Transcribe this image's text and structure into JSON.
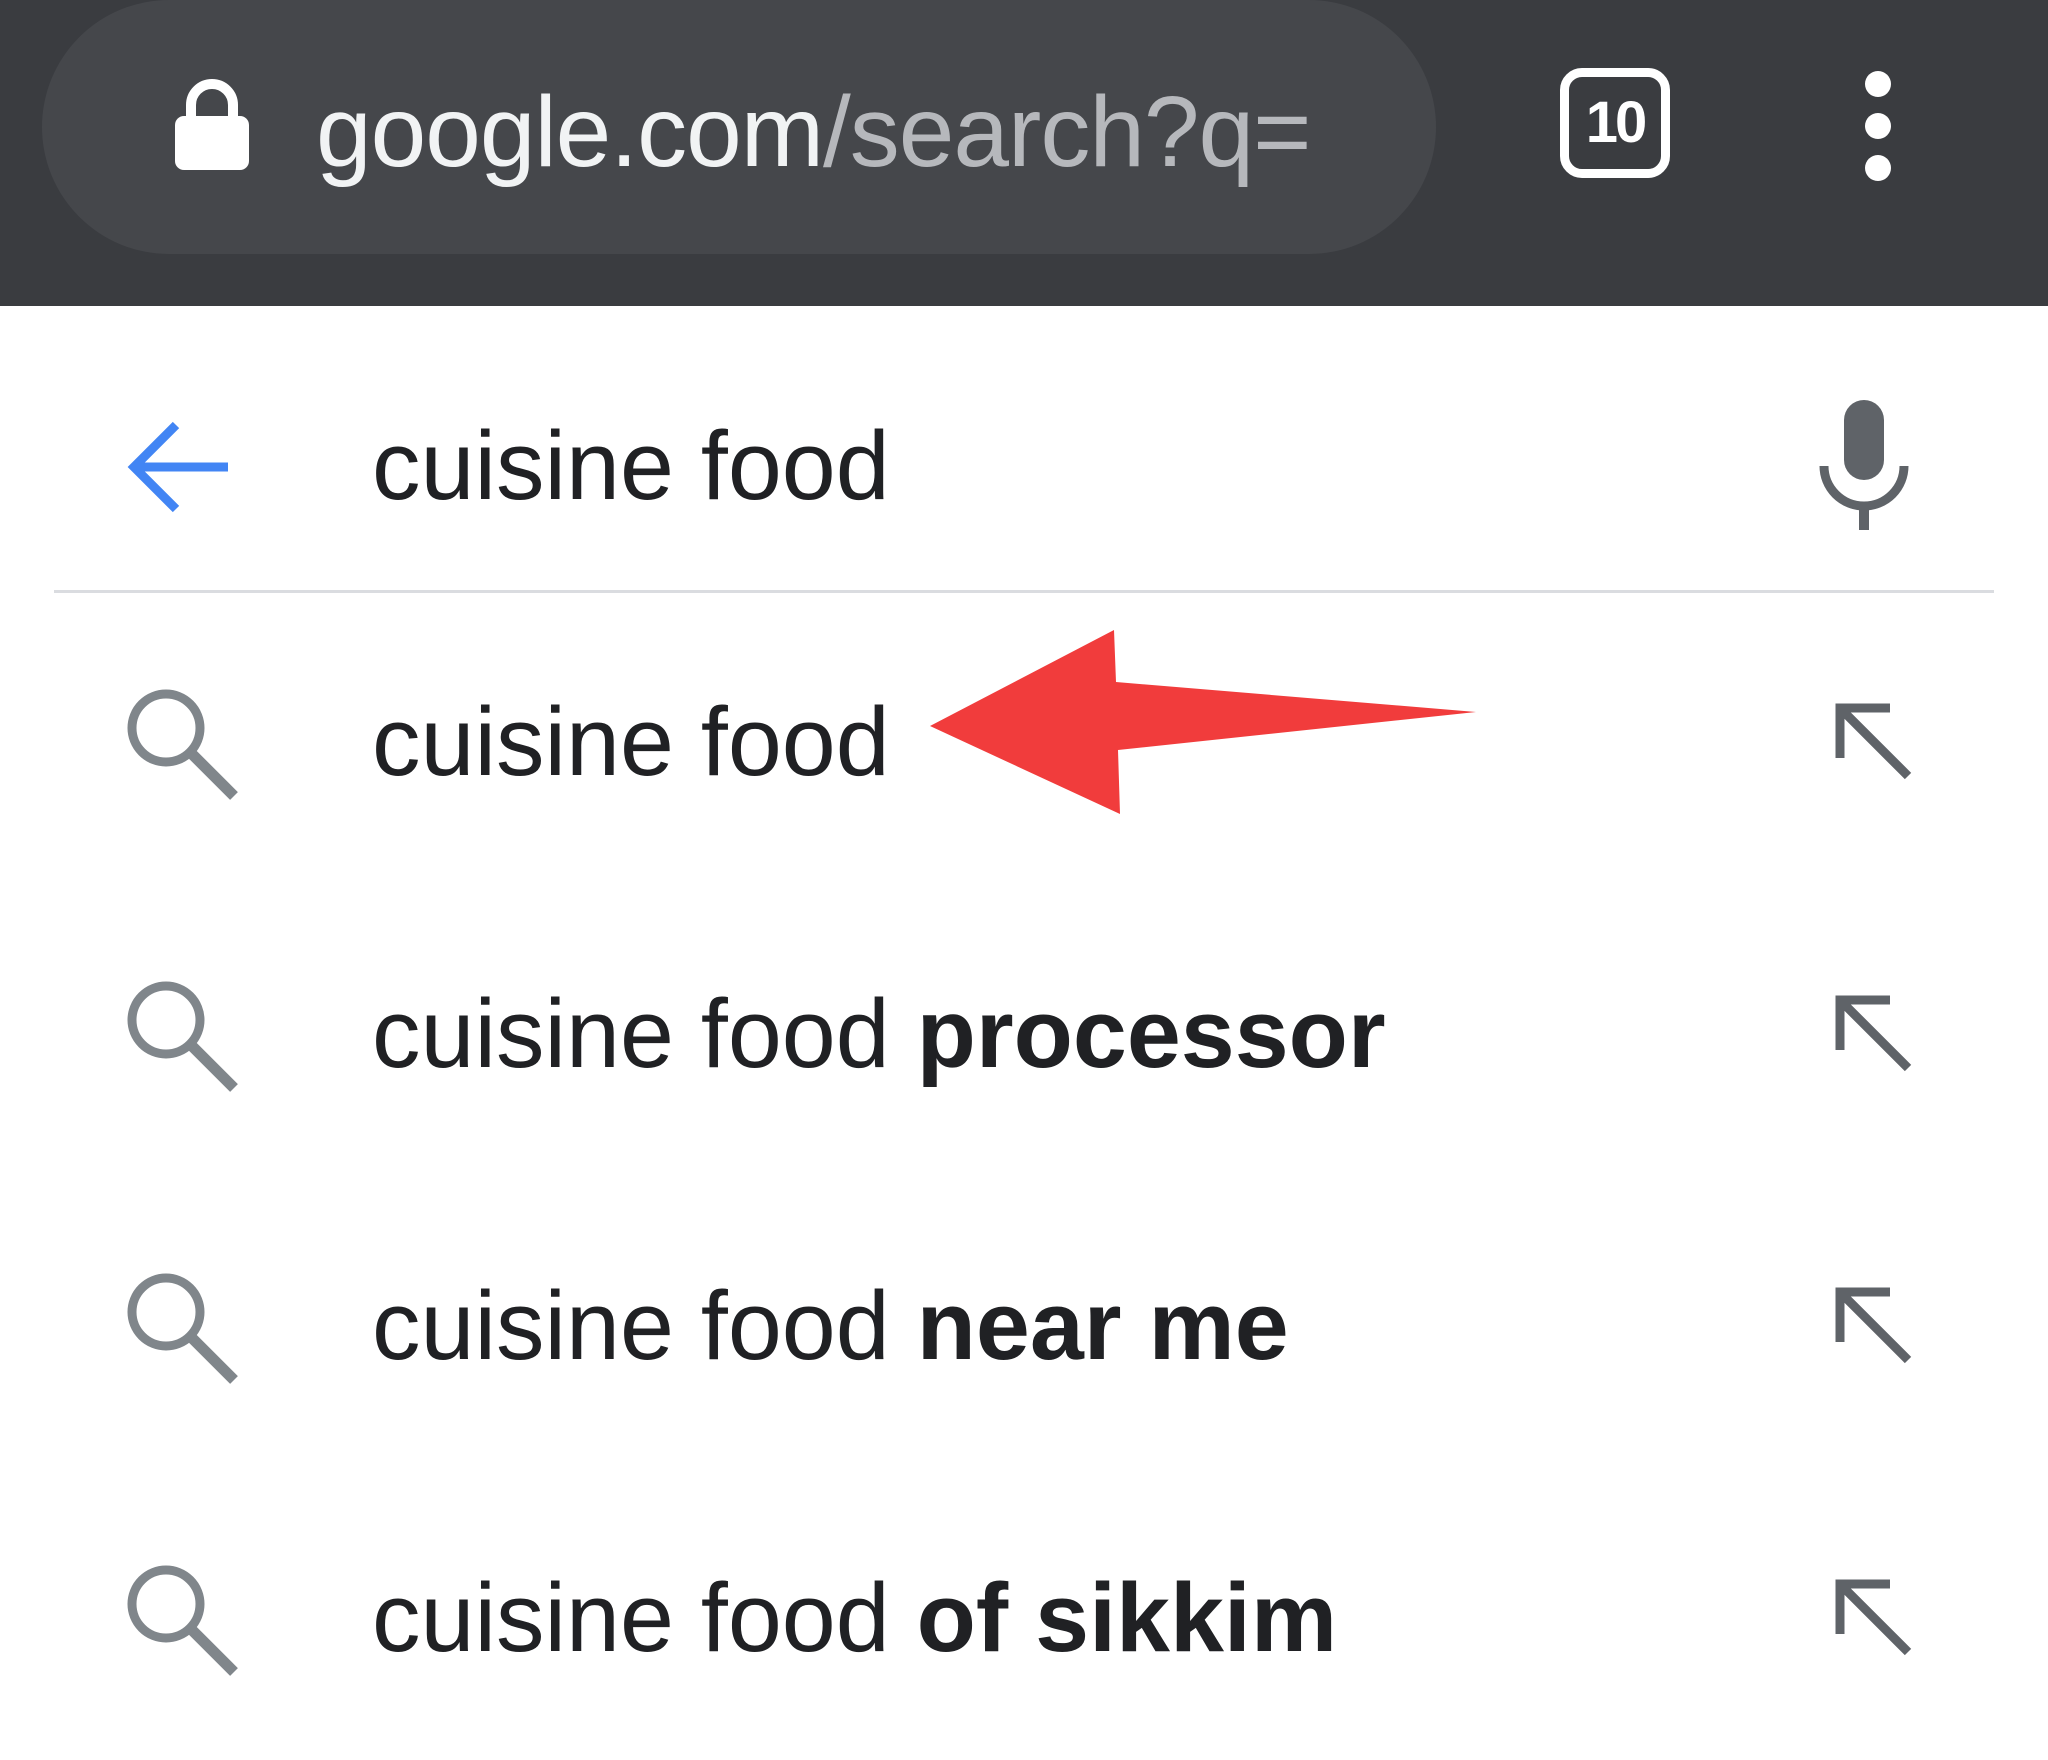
{
  "browser": {
    "url_host": "google.com",
    "url_path": "/search?q=",
    "tab_count": "10",
    "icons": {
      "lock": "lock-icon",
      "menu": "more-vert-icon"
    }
  },
  "search": {
    "query": "cuisine food",
    "icons": {
      "back": "arrow-back-icon",
      "voice": "mic-icon"
    },
    "accent_color": "#4285f4"
  },
  "suggestions": [
    {
      "prefix": "cuisine food",
      "completion": ""
    },
    {
      "prefix": "cuisine food ",
      "completion": "processor"
    },
    {
      "prefix": "cuisine food ",
      "completion": "near me"
    },
    {
      "prefix": "cuisine food ",
      "completion": "of sikkim"
    }
  ],
  "annotation": {
    "type": "red-arrow",
    "color": "#f13c3c",
    "points_to": "suggestion-1"
  }
}
